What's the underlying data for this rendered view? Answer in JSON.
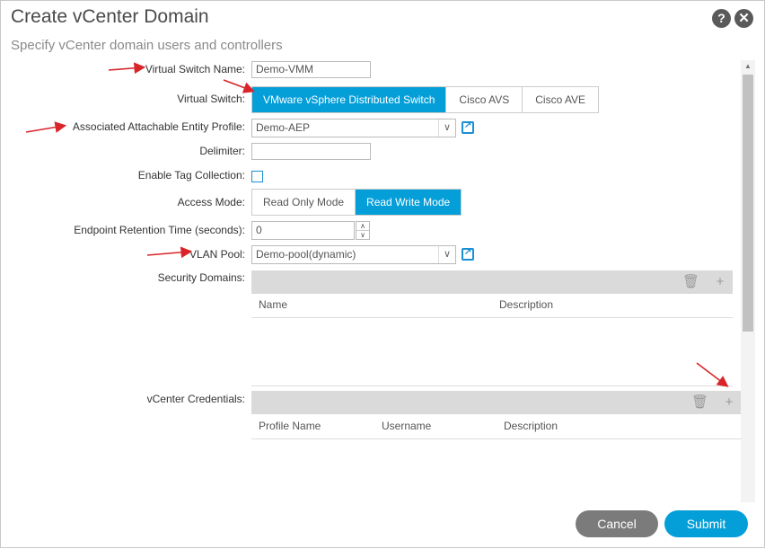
{
  "dialog": {
    "title": "Create vCenter Domain",
    "subtitle": "Specify vCenter domain users and controllers",
    "help_icon": "?",
    "close_icon": "✕"
  },
  "form": {
    "virtual_switch_name": {
      "label": "Virtual Switch Name:",
      "value": "Demo-VMM"
    },
    "virtual_switch": {
      "label": "Virtual Switch:",
      "options": [
        "VMware vSphere Distributed Switch",
        "Cisco AVS",
        "Cisco AVE"
      ],
      "selected": "VMware vSphere Distributed Switch"
    },
    "aaep": {
      "label": "Associated Attachable Entity Profile:",
      "value": "Demo-AEP"
    },
    "delimiter": {
      "label": "Delimiter:",
      "value": ""
    },
    "enable_tag_collection": {
      "label": "Enable Tag Collection:",
      "checked": false
    },
    "access_mode": {
      "label": "Access Mode:",
      "options": [
        "Read Only Mode",
        "Read Write Mode"
      ],
      "selected": "Read Write Mode"
    },
    "endpoint_retention": {
      "label": "Endpoint Retention Time (seconds):",
      "value": "0"
    },
    "vlan_pool": {
      "label": "VLAN Pool:",
      "value": "Demo-pool(dynamic)"
    },
    "security_domains": {
      "label": "Security Domains:",
      "columns": [
        "Name",
        "Description"
      ],
      "rows": []
    },
    "vcenter_credentials": {
      "label": "vCenter Credentials:",
      "columns": [
        "Profile Name",
        "Username",
        "Description"
      ],
      "rows": []
    }
  },
  "icons": {
    "trash": "🗑",
    "add": "+"
  },
  "footer": {
    "cancel_label": "Cancel",
    "submit_label": "Submit"
  },
  "colors": {
    "accent": "#049fd9",
    "cancel": "#7b7b7b",
    "annotation_arrow": "#d9252a"
  }
}
